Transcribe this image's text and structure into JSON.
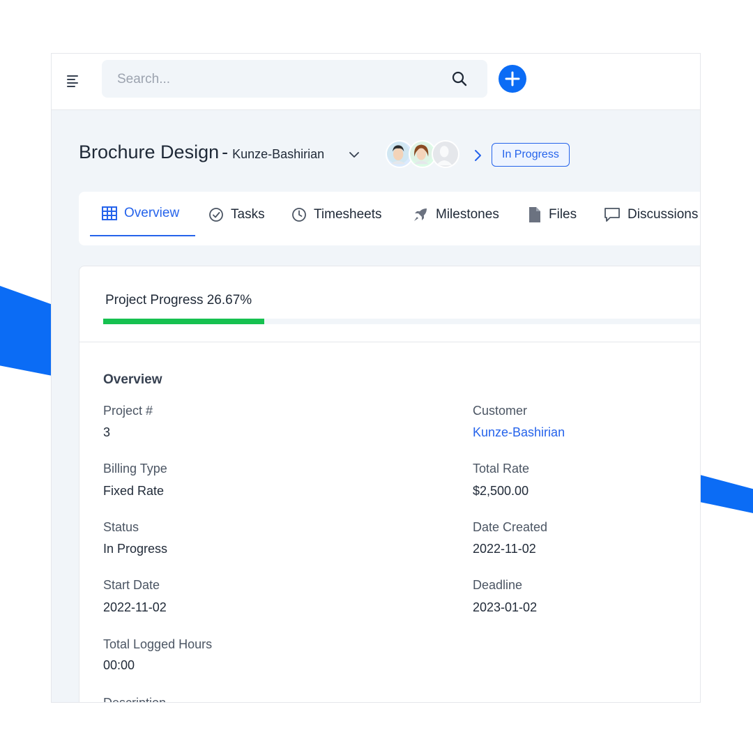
{
  "search": {
    "placeholder": "Search..."
  },
  "header": {
    "project_name": "Brochure Design",
    "separator": "-",
    "customer": "Kunze-Bashirian",
    "status": "In Progress"
  },
  "tabs": [
    {
      "label": "Overview",
      "icon": "table-icon",
      "active": true
    },
    {
      "label": "Tasks",
      "icon": "check-circle-icon"
    },
    {
      "label": "Timesheets",
      "icon": "clock-icon"
    },
    {
      "label": "Milestones",
      "icon": "rocket-icon"
    },
    {
      "label": "Files",
      "icon": "file-icon"
    },
    {
      "label": "Discussions",
      "icon": "chat-icon"
    }
  ],
  "progress": {
    "label": "Project Progress 26.67%",
    "percent": 26.67,
    "color": "#16c150"
  },
  "overview": {
    "title": "Overview",
    "fields": [
      {
        "label": "Project #",
        "value": "3"
      },
      {
        "label": "Customer",
        "value": "Kunze-Bashirian"
      },
      {
        "label": "Billing Type",
        "value": "Fixed Rate"
      },
      {
        "label": "Total Rate",
        "value": "$2,500.00"
      },
      {
        "label": "Status",
        "value": "In Progress"
      },
      {
        "label": "Date Created",
        "value": "2022-11-02"
      },
      {
        "label": "Start Date",
        "value": "2022-11-02"
      },
      {
        "label": "Deadline",
        "value": "2023-01-02"
      },
      {
        "label": "Total Logged Hours",
        "value": "00:00"
      },
      {
        "label": "Description"
      }
    ]
  },
  "colors": {
    "accent": "#2563eb",
    "brand": "#0b6cf5",
    "progress": "#16c150"
  }
}
